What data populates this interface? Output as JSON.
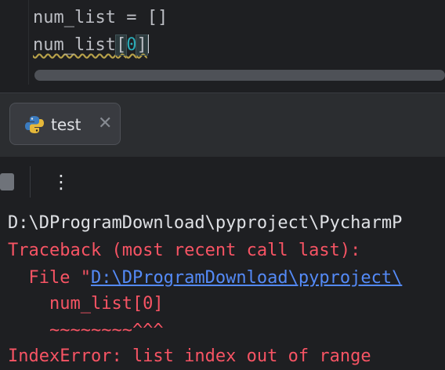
{
  "editor": {
    "line1": "num_list = []",
    "line2_name": "num_list",
    "line2_open": "[",
    "line2_index": "0",
    "line2_close": "]"
  },
  "run_tab": {
    "label": "test",
    "icon": "python-icon",
    "close_icon": "close-icon"
  },
  "toolbar": {
    "stop_icon": "stop-icon",
    "more_label": "⋮"
  },
  "console": {
    "path_line": "D:\\DProgramDownload\\pyproject\\PycharmP",
    "traceback_line": "Traceback (most recent call last):",
    "file_prefix": "  File \"",
    "file_link": "D:\\DProgramDownload\\pyproject\\",
    "code_line": "    num_list[0]",
    "carets_line": "    ~~~~~~~~^^^",
    "error_line": "IndexError: list index out of range"
  },
  "colors": {
    "background": "#1e1f22",
    "error_red": "#f75464",
    "link_blue": "#548af7",
    "number_teal": "#2aacb8"
  }
}
